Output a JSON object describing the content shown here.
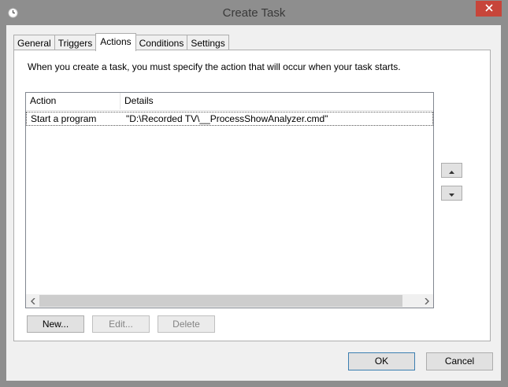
{
  "window": {
    "title": "Create Task"
  },
  "tabs": [
    {
      "label": "General",
      "active": false
    },
    {
      "label": "Triggers",
      "active": false
    },
    {
      "label": "Actions",
      "active": true
    },
    {
      "label": "Conditions",
      "active": false
    },
    {
      "label": "Settings",
      "active": false
    }
  ],
  "actions_tab": {
    "instruction": "When you create a task, you must specify the action that will occur when your task starts.",
    "columns": [
      "Action",
      "Details"
    ],
    "rows": [
      {
        "action": "Start a program",
        "details": "\"D:\\Recorded TV\\__ProcessShowAnalyzer.cmd\""
      }
    ],
    "buttons": {
      "new": "New...",
      "edit": "Edit...",
      "delete": "Delete"
    }
  },
  "dialog_buttons": {
    "ok": "OK",
    "cancel": "Cancel"
  },
  "icons": {
    "title": "clock-icon",
    "close": "close-icon",
    "move_up": "arrow-up-icon",
    "move_down": "arrow-down-icon",
    "scroll_left": "chevron-left-icon",
    "scroll_right": "chevron-right-icon"
  },
  "colors": {
    "titlebar": "#8e8e8e",
    "close_button": "#c7453a",
    "dialog_bg": "#f0f0f0",
    "default_button_border": "#3c7fb1"
  }
}
